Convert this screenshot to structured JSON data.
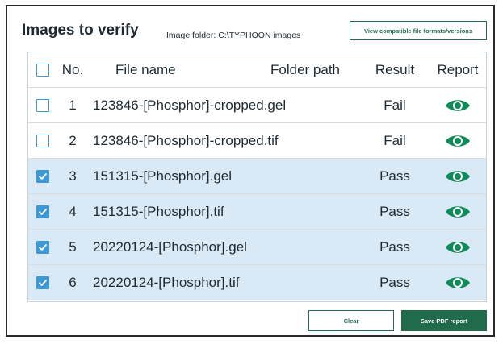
{
  "header": {
    "title": "Images to verify",
    "folder_label": "Image folder: C:\\TYPHOON images",
    "compat_button": "View compatible file formats/versions"
  },
  "table": {
    "columns": {
      "no": "No.",
      "file": "File name",
      "folder": "Folder path",
      "result": "Result",
      "report": "Report"
    },
    "header_checked": false,
    "rows": [
      {
        "no": "1",
        "file": "123846-[Phosphor]-cropped.gel",
        "folder": "",
        "result": "Fail",
        "checked": false
      },
      {
        "no": "2",
        "file": "123846-[Phosphor]-cropped.tif",
        "folder": "",
        "result": "Fail",
        "checked": false
      },
      {
        "no": "3",
        "file": "151315-[Phosphor].gel",
        "folder": "",
        "result": "Pass",
        "checked": true
      },
      {
        "no": "4",
        "file": "151315-[Phosphor].tif",
        "folder": "",
        "result": "Pass",
        "checked": true
      },
      {
        "no": "5",
        "file": "20220124-[Phosphor].gel",
        "folder": "",
        "result": "Pass",
        "checked": true
      },
      {
        "no": "6",
        "file": "20220124-[Phosphor].tif",
        "folder": "",
        "result": "Pass",
        "checked": true
      }
    ]
  },
  "footer": {
    "clear_label": "Clear",
    "save_label": "Save PDF report"
  },
  "colors": {
    "accent_green": "#1f6b4c",
    "eye_green": "#0f8a58",
    "checkbox_blue": "#3d98d6",
    "selected_row": "#d9e9f6"
  },
  "icons": {
    "report": "eye-icon",
    "check": "checkmark-icon"
  }
}
